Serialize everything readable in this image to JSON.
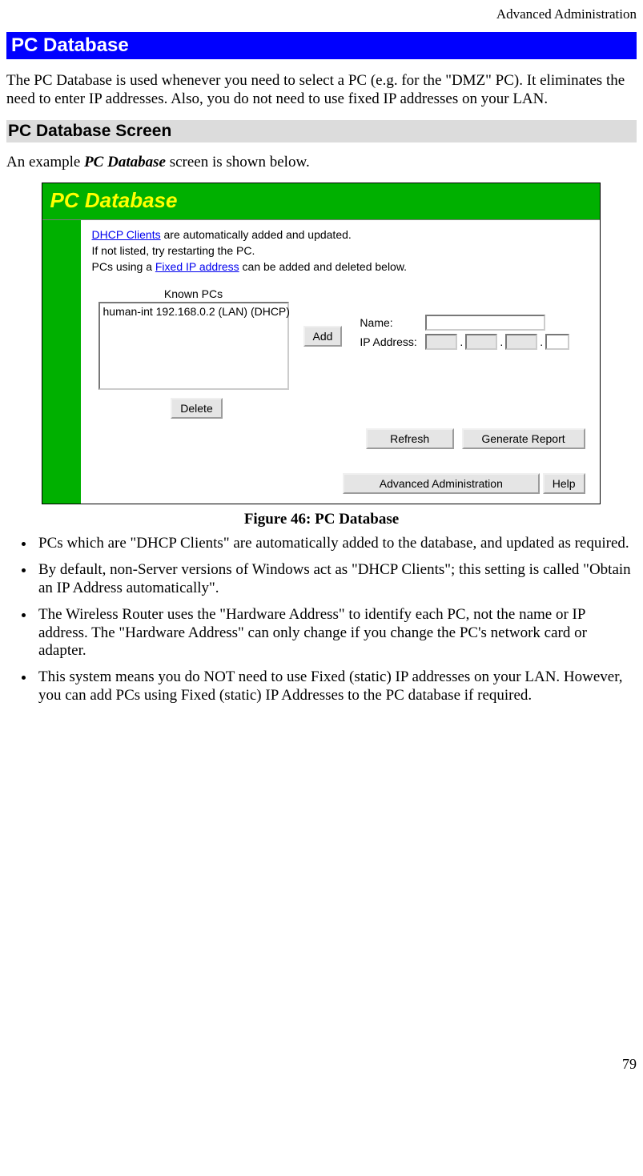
{
  "header": {
    "breadcrumb": "Advanced Administration"
  },
  "h1": "PC Database",
  "intro": "The PC Database is used whenever you need to select a PC (e.g. for the \"DMZ\" PC). It eliminates the need to enter IP addresses. Also, you do not need to use fixed IP addresses on your LAN.",
  "h2": "PC Database Screen",
  "example_sentence_prefix": "An example ",
  "example_sentence_bold": "PC Database",
  "example_sentence_suffix": " screen is shown below.",
  "screenshot": {
    "title": "PC Database",
    "info_line1_link": "DHCP Clients",
    "info_line1_rest": " are automatically added and updated.",
    "info_line2": "If not listed, try restarting the PC.",
    "info_line3_prefix": "PCs using a ",
    "info_line3_link": "Fixed IP address",
    "info_line3_suffix": " can be added and deleted below.",
    "known_pcs_label": "Known PCs",
    "list_item": "human-int 192.168.0.2 (LAN) (DHCP)",
    "add_btn": "Add",
    "name_label": "Name:",
    "ip_label": "IP Address:",
    "delete_btn": "Delete",
    "refresh_btn": "Refresh",
    "report_btn": "Generate Report",
    "adv_btn": "Advanced Administration",
    "help_btn": "Help"
  },
  "figure_caption": "Figure 46: PC Database",
  "bullets": [
    "PCs which are \"DHCP Clients\" are automatically added to the database, and updated as required.",
    "By default, non-Server versions of Windows act as \"DHCP Clients\"; this setting is called \"Obtain an IP Address automatically\".",
    "The Wireless Router uses the \"Hardware Address\" to identify each PC, not the name or IP address. The \"Hardware Address\" can only change if you change the PC's network card or adapter.",
    "This system means you do NOT need to use Fixed (static) IP addresses on your LAN. However, you can add PCs using Fixed (static) IP Addresses to the PC database if required."
  ],
  "page_number": "79"
}
